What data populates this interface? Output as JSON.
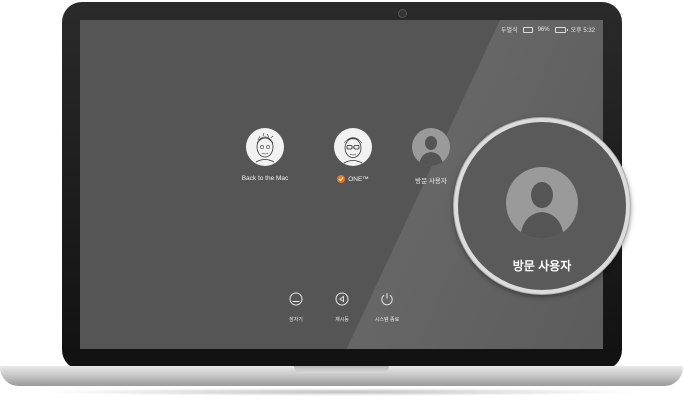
{
  "menubar": {
    "input_source": "두벌식",
    "battery_percent": "96%",
    "clock": "오후 5:32",
    "icons": [
      "keyboard-icon",
      "battery-charging-icon"
    ]
  },
  "users": [
    {
      "name": "Back to the Mac",
      "avatar": "sketch-face-avatar",
      "selected": false
    },
    {
      "name": "ONE™",
      "avatar": "sketch-face-glasses-avatar",
      "selected": true
    },
    {
      "name": "방문 사용자",
      "avatar": "guest-silhouette-avatar",
      "selected": false
    }
  ],
  "controls": [
    {
      "label": "잠자기",
      "icon": "sleep-icon"
    },
    {
      "label": "재시동",
      "icon": "restart-icon"
    },
    {
      "label": "시스템 종료",
      "icon": "power-icon"
    }
  ],
  "magnifier": {
    "label": "방문 사용자",
    "icon": "guest-silhouette-icon"
  },
  "colors": {
    "screen": "#555555",
    "selected_badge": "#e87722",
    "text": "#f2f2f2"
  }
}
